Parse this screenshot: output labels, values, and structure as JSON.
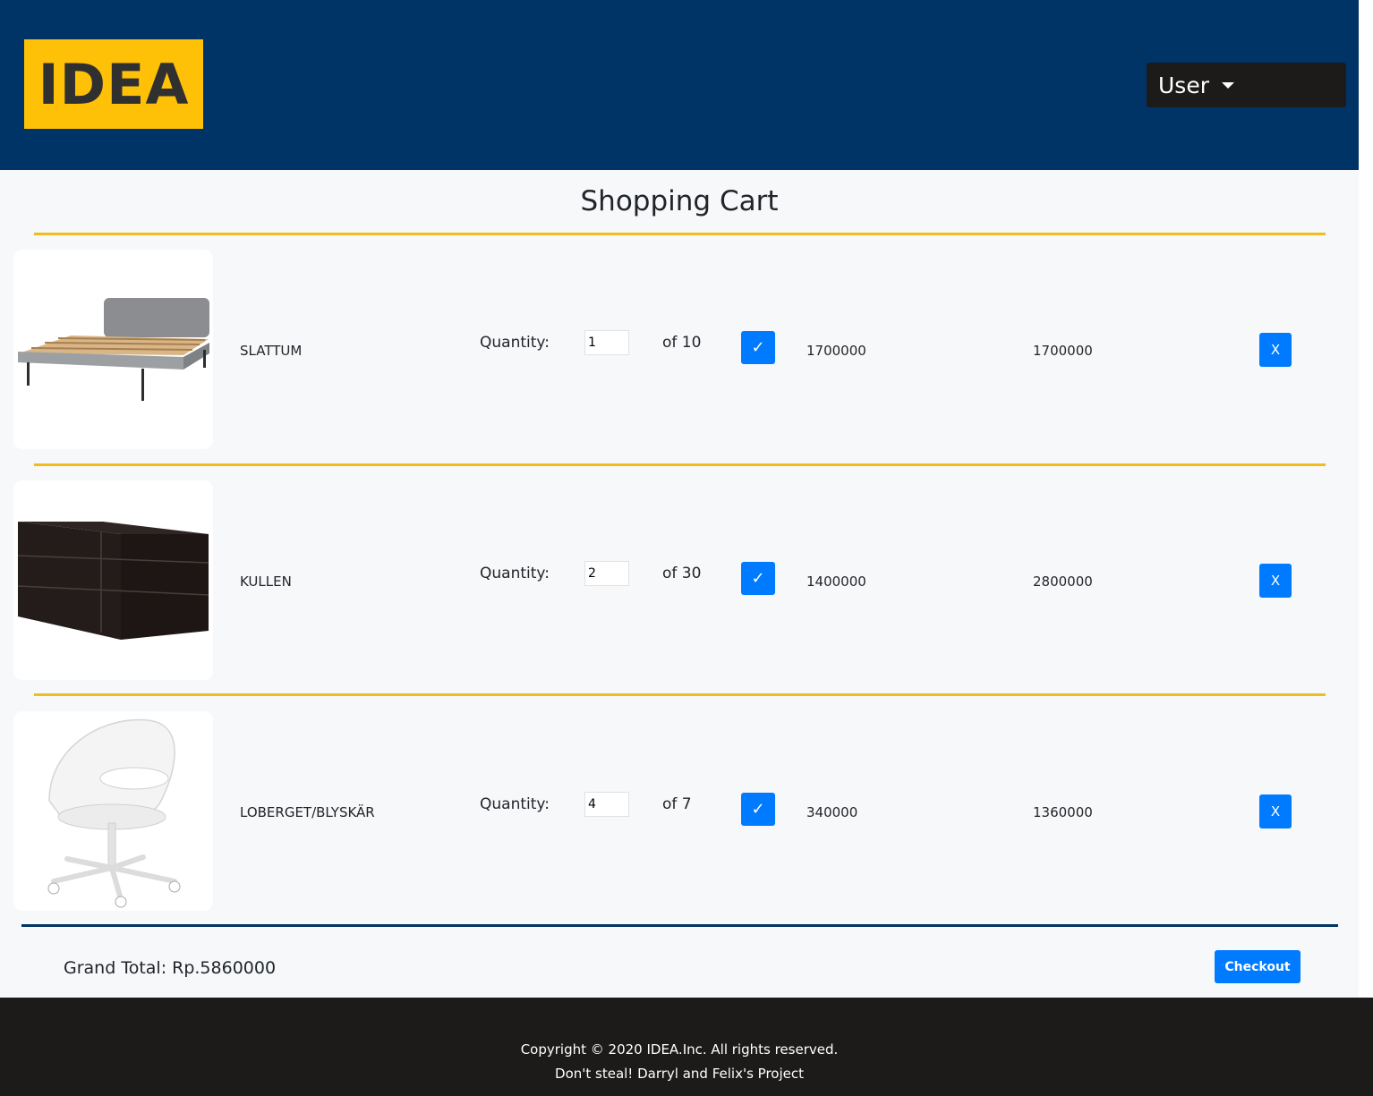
{
  "header": {
    "logo_text": "IDEA",
    "user_menu_label": "User"
  },
  "cart": {
    "title": "Shopping Cart",
    "quantity_label": "Quantity:",
    "confirm_symbol": "✓",
    "remove_label": "X",
    "items": [
      {
        "name": "SLATTUM",
        "quantity": "1",
        "stock": "of 10",
        "price": "1700000",
        "subtotal": "1700000"
      },
      {
        "name": "KULLEN",
        "quantity": "2",
        "stock": "of 30",
        "price": "1400000",
        "subtotal": "2800000"
      },
      {
        "name": "LOBERGET/BLYSKÄR",
        "quantity": "4",
        "stock": "of 7",
        "price": "340000",
        "subtotal": "1360000"
      }
    ],
    "grand_total": "Grand Total: Rp.5860000",
    "checkout_label": "Checkout"
  },
  "footer": {
    "copyright": "Copyright © 2020 IDEA.Inc. All rights reserved.",
    "credit": "Don't steal! Darryl and Felix's Project"
  },
  "colors": {
    "navy": "#003366",
    "gold": "#ffc107",
    "primary": "#007bff",
    "dark": "#1c1b19"
  }
}
